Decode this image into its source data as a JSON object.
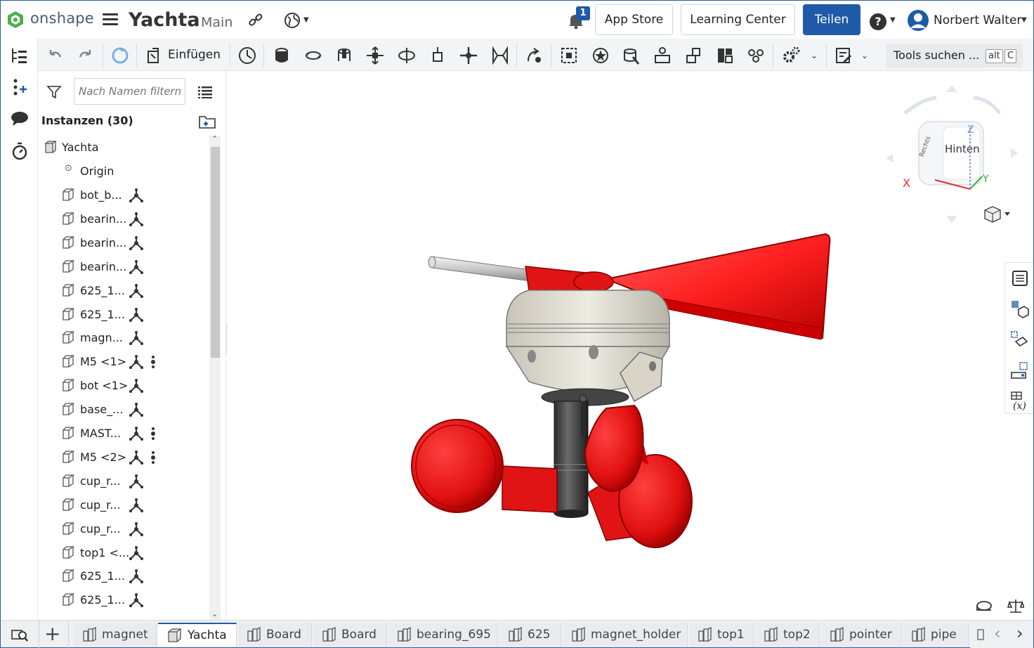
{
  "app": {
    "brand": "onshape",
    "doc_title": "Yachta",
    "branch": "Main",
    "notification_count": "1",
    "app_store": "App Store",
    "learning_center": "Learning Center",
    "share": "Teilen",
    "help": "?",
    "user_name": "Norbert Walter",
    "accent": "#1e5aa8"
  },
  "toolbar": {
    "insert_label": "Einfügen",
    "tools_search": "Tools suchen ...",
    "shortcut_alt": "alt",
    "shortcut_key": "C"
  },
  "panel": {
    "filter_placeholder": "Nach Namen filtern",
    "title": "Instanzen (30)",
    "root": "Yachta",
    "origin": "Origin",
    "items": [
      {
        "label": "bot_b...",
        "dot": false
      },
      {
        "label": "bearin...",
        "dot": false
      },
      {
        "label": "bearin...",
        "dot": false
      },
      {
        "label": "bearin...",
        "dot": false
      },
      {
        "label": "625_1...",
        "dot": false
      },
      {
        "label": "625_1...",
        "dot": false
      },
      {
        "label": "magn...",
        "dot": false
      },
      {
        "label": "M5 <1>",
        "dot": true
      },
      {
        "label": "bot <1>",
        "dot": false
      },
      {
        "label": "base_...",
        "dot": false
      },
      {
        "label": "MAST...",
        "dot": true
      },
      {
        "label": "M5 <2>",
        "dot": true
      },
      {
        "label": "cup_r...",
        "dot": false
      },
      {
        "label": "cup_r...",
        "dot": false
      },
      {
        "label": "cup_r...",
        "dot": false
      },
      {
        "label": "top1 <...",
        "dot": false
      },
      {
        "label": "625_1...",
        "dot": false
      },
      {
        "label": "625_1...",
        "dot": false
      }
    ]
  },
  "viewcube": {
    "face_back": "Hinten",
    "face_right": "Rechts",
    "axis_x": "X",
    "axis_y": "Y",
    "axis_z": "Z"
  },
  "model": {
    "part_color": "#e01414",
    "body_color": "#d9d6cc"
  },
  "tabs": [
    {
      "label": "magnet",
      "active": false
    },
    {
      "label": "Yachta",
      "active": true
    },
    {
      "label": "Board",
      "active": false
    },
    {
      "label": "Board",
      "active": false
    },
    {
      "label": "bearing_695",
      "active": false
    },
    {
      "label": "625",
      "active": false
    },
    {
      "label": "magnet_holder",
      "active": false
    },
    {
      "label": "top1",
      "active": false
    },
    {
      "label": "top2",
      "active": false
    },
    {
      "label": "pointer",
      "active": false
    },
    {
      "label": "pipe",
      "active": false
    }
  ]
}
